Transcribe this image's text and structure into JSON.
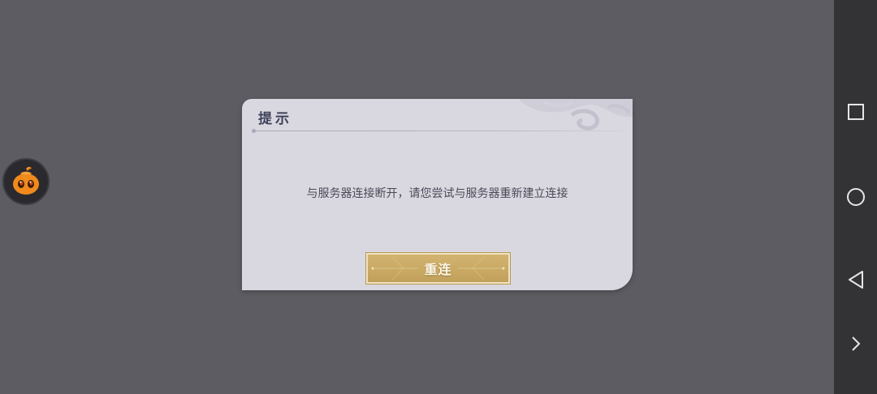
{
  "dialog": {
    "title": "提示",
    "message": "与服务器连接断开，请您尝试与服务器重新建立连接",
    "reconnect_label": "重连"
  },
  "floating_assistant": {
    "icon": "orange-mascot-icon"
  },
  "navbar": {
    "items": [
      {
        "name": "recent-apps",
        "icon": "square-icon"
      },
      {
        "name": "home",
        "icon": "circle-icon"
      },
      {
        "name": "back",
        "icon": "triangle-back-icon"
      },
      {
        "name": "expand",
        "icon": "chevron-right-icon"
      }
    ]
  },
  "colors": {
    "background": "#5c5c62",
    "dialog_bg": "#d9d8e1",
    "title_text": "#3e4158",
    "button_gold": "#c8a862",
    "navbar_bg": "#333336",
    "mascot_orange": "#f08a1c"
  }
}
